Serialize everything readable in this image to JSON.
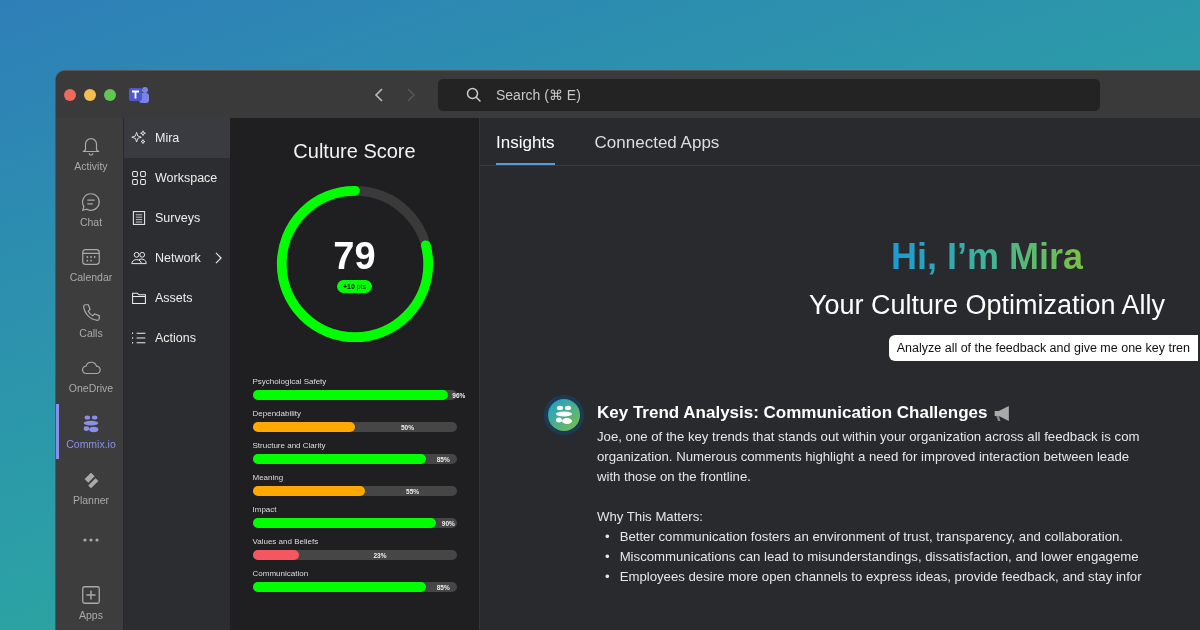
{
  "titlebar": {
    "back": {
      "disabled": false
    },
    "forward": {
      "disabled": true
    },
    "search": {
      "placeholder": "Search (⌘ E)"
    }
  },
  "rail": [
    {
      "label": "Activity",
      "selected": false
    },
    {
      "label": "Chat",
      "selected": false
    },
    {
      "label": "Calendar",
      "selected": false
    },
    {
      "label": "Calls",
      "selected": false
    },
    {
      "label": "OneDrive",
      "selected": false
    },
    {
      "label": "Commix.io",
      "selected": true
    },
    {
      "label": "Planner",
      "selected": false
    },
    {
      "kind": "more",
      "selected": false
    },
    {
      "label": "Apps",
      "selected": false
    }
  ],
  "nav": [
    {
      "label": "Mira",
      "selected": true,
      "expandable": false
    },
    {
      "label": "Workspace",
      "selected": false,
      "expandable": false
    },
    {
      "label": "Surveys",
      "selected": false,
      "expandable": false
    },
    {
      "label": "Network",
      "selected": false,
      "expandable": true
    },
    {
      "label": "Assets",
      "selected": false,
      "expandable": false
    },
    {
      "label": "Actions",
      "selected": false,
      "expandable": false
    }
  ],
  "culture": {
    "title": "Culture Score",
    "score": "79",
    "level": 0.79,
    "change": "**+10** pts",
    "metrics": [
      {
        "name": "Psychological Safety",
        "level": 0.96,
        "reading": "96%",
        "color": "#00ff00"
      },
      {
        "name": "Dependability",
        "level": 0.5,
        "reading": "50%",
        "color": "#ffa800"
      },
      {
        "name": "Structure and Clarity",
        "level": 0.85,
        "reading": "85%",
        "color": "#00ff00"
      },
      {
        "name": "Meaning",
        "level": 0.55,
        "reading": "55%",
        "color": "#ffa800"
      },
      {
        "name": "Impact",
        "level": 0.9,
        "reading": "90%",
        "color": "#00ff00"
      },
      {
        "name": "Values and Beliefs",
        "level": 0.23,
        "reading": "23%",
        "color": "#f5565f"
      },
      {
        "name": "Communication",
        "level": 0.85,
        "reading": "85%",
        "color": "#00ff00"
      }
    ]
  },
  "tabs": [
    {
      "label": "Insights",
      "selected": true
    },
    {
      "label": "Connected Apps",
      "selected": false
    }
  ],
  "hero": {
    "greeting": "Hi, I’m Mira",
    "subtitle": "Your Culture Optimization Ally",
    "prompt": "Analyze all of the feedback and give me one key tren"
  },
  "message": {
    "title": "Key Trend Analysis: Communication Challenges",
    "lines": [
      "Joe, one of the key trends that stands out within your organization across all feedback is com",
      "organization. Numerous comments highlight a need for improved interaction between leade",
      "with those on the frontline."
    ],
    "subheading": "Why This Matters:",
    "bullets": [
      {
        "mark": "•",
        "text": "Better communication fosters an environment of trust, transparency, and collaboration."
      },
      {
        "mark": "•",
        "text": "Miscommunications can lead to misunderstandings, dissatisfaction, and lower engageme"
      },
      {
        "mark": "•",
        "text": "Employees desire more open channels to express ideas, provide feedback, and stay infor"
      }
    ]
  }
}
